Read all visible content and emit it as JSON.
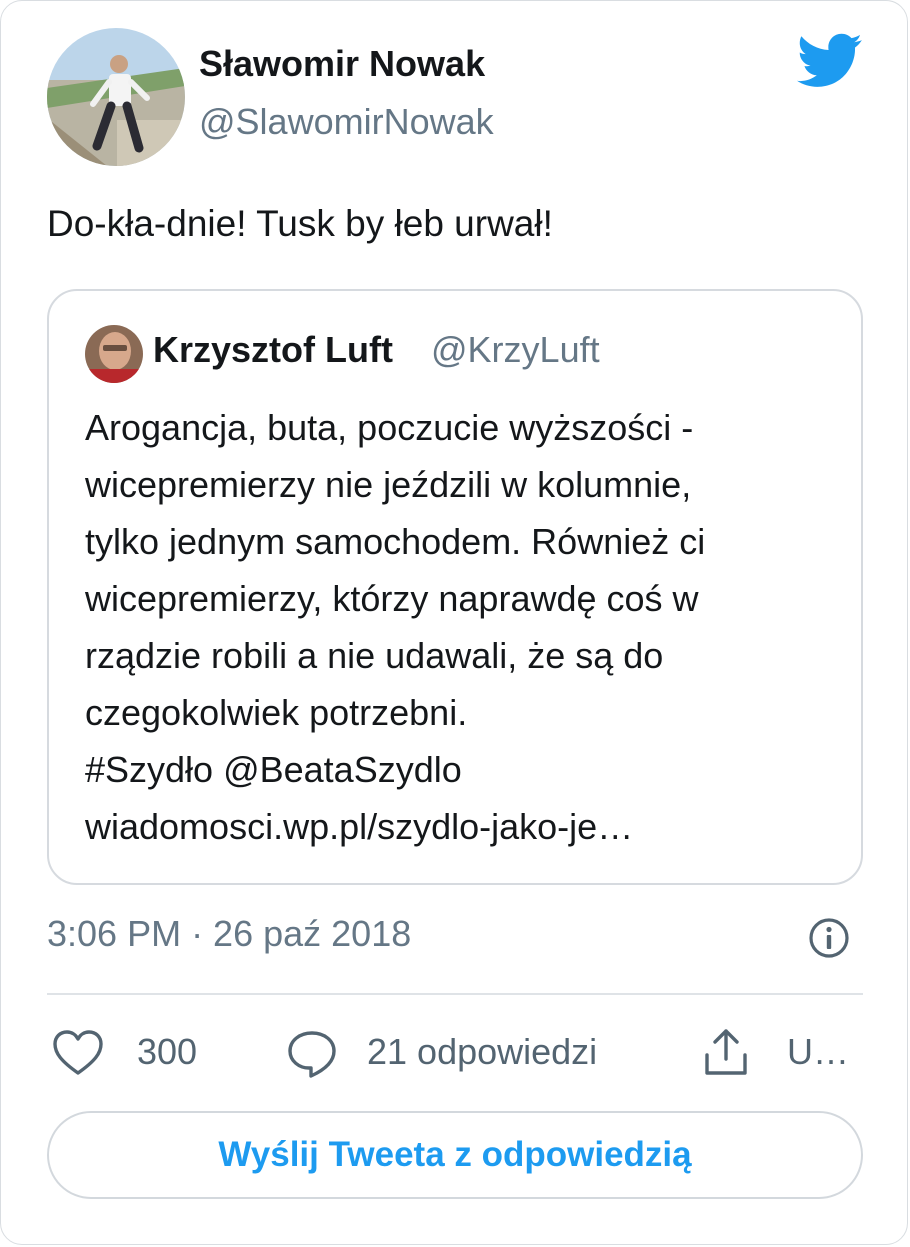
{
  "author": {
    "name": "Sławomir Nowak",
    "handle": "@SlawomirNowak"
  },
  "tweet": {
    "text": "Do-kła-dnie! Tusk by łeb urwał!"
  },
  "quoted_tweet": {
    "name": "Krzysztof Luft",
    "handle": "@KrzyLuft",
    "lines": [
      "Arogancja, buta, poczucie wyższości -",
      "wicepremierzy nie jeździli w kolumnie,",
      "tylko jednym samochodem. Również ci",
      "wicepremierzy, którzy naprawdę coś w",
      "rządzie robili a nie udawali, że są do",
      "czegokolwiek potrzebni.",
      "#Szydło @BeataSzydlo",
      "wiadomosci.wp.pl/szydlo-jako-je…"
    ]
  },
  "meta": {
    "timestamp": "3:06 PM · 26 paź 2018"
  },
  "actions": {
    "likes": "300",
    "replies": "21 odpowiedzi",
    "share": "U…"
  },
  "reply_button": {
    "label": "Wyślij Tweeta z odpowiedzią"
  },
  "colors": {
    "twitter_blue": "#1d9bf0",
    "secondary_text": "#657786",
    "border": "#d9dde1"
  },
  "icons": {
    "brand": "twitter-bird-icon",
    "info": "info-icon",
    "like": "heart-icon",
    "reply": "speech-bubble-icon",
    "share": "share-icon"
  }
}
